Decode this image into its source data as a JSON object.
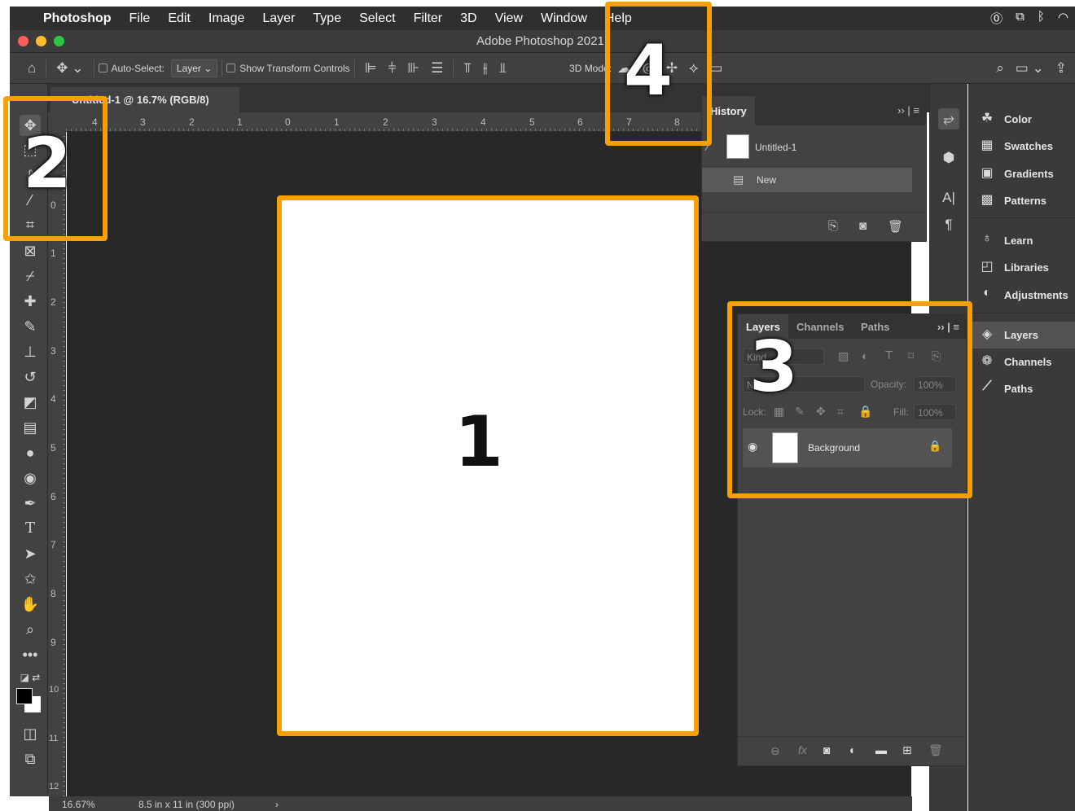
{
  "menubar": {
    "app": "Photoshop",
    "items": [
      "File",
      "Edit",
      "Image",
      "Layer",
      "Type",
      "Select",
      "Filter",
      "3D",
      "View",
      "Window",
      "Help"
    ]
  },
  "window": {
    "title": "Adobe Photoshop 2021"
  },
  "options_bar": {
    "auto_select_label": "Auto-Select:",
    "auto_select_value": "Layer",
    "show_transform_label": "Show Transform Controls",
    "mode_3d_label": "3D Mode:"
  },
  "document": {
    "tab_title": "Untitled-1 @ 16.7% (RGB/8)",
    "zoom": "16.67%",
    "doc_info": "8.5 in x 11 in (300 ppi)",
    "h_ruler": [
      "4",
      "3",
      "2",
      "1",
      "0",
      "1",
      "2",
      "3",
      "4",
      "5",
      "6",
      "7",
      "8"
    ],
    "v_ruler": [
      "0",
      "1",
      "2",
      "3",
      "4",
      "5",
      "6",
      "7",
      "8",
      "9",
      "10",
      "11",
      "12"
    ]
  },
  "history": {
    "title": "History",
    "snapshot": "Untitled-1",
    "items": [
      "New"
    ]
  },
  "layers_panel": {
    "tabs": [
      "Layers",
      "Channels",
      "Paths"
    ],
    "kind_label": "Kind",
    "blend_mode": "Normal",
    "opacity_label": "Opacity:",
    "opacity_value": "100%",
    "lock_label": "Lock:",
    "fill_label": "Fill:",
    "fill_value": "100%",
    "layer_name": "Background"
  },
  "right_panels": [
    "Color",
    "Swatches",
    "Gradients",
    "Patterns",
    "Learn",
    "Libraries",
    "Adjustments",
    "Layers",
    "Channels",
    "Paths"
  ],
  "callouts": [
    "1",
    "2",
    "3",
    "4"
  ],
  "colors": {
    "accent": "#f7a000",
    "panel": "#424242",
    "canvas": "#282828"
  }
}
